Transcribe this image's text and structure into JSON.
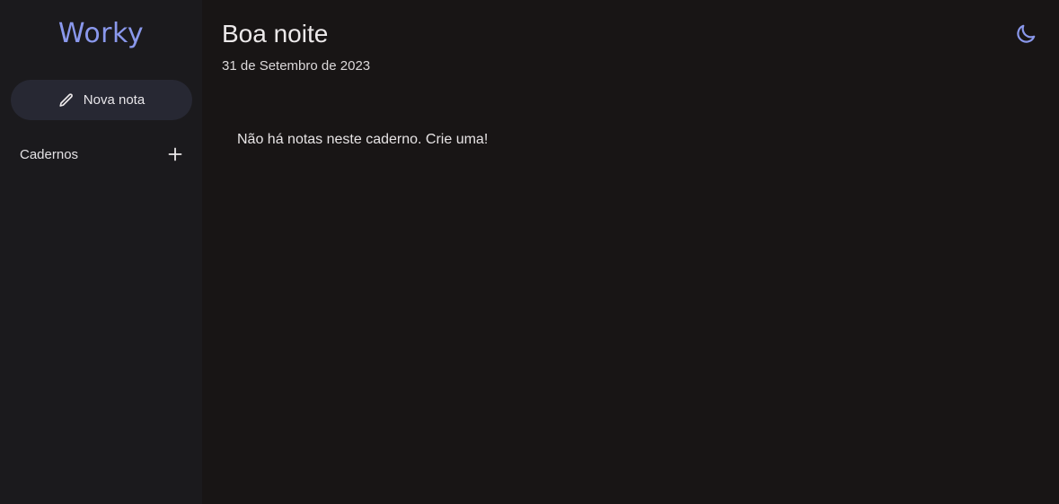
{
  "app": {
    "logo": "Worky"
  },
  "sidebar": {
    "new_note_label": "Nova nota",
    "notebooks_label": "Cadernos",
    "icons": {
      "new_note": "pencil-icon",
      "add_notebook": "plus-icon"
    }
  },
  "main": {
    "greeting": "Boa noite",
    "date": "31 de Setembro de 2023",
    "empty_message": "Não há notas neste caderno. Crie uma!",
    "theme_toggle_icon": "moon-icon"
  },
  "colors": {
    "accent": "#8a98ec",
    "sidebar_bg": "#1b1a1d",
    "main_bg": "#181515",
    "button_bg": "#272833",
    "text": "#ece9ea"
  }
}
